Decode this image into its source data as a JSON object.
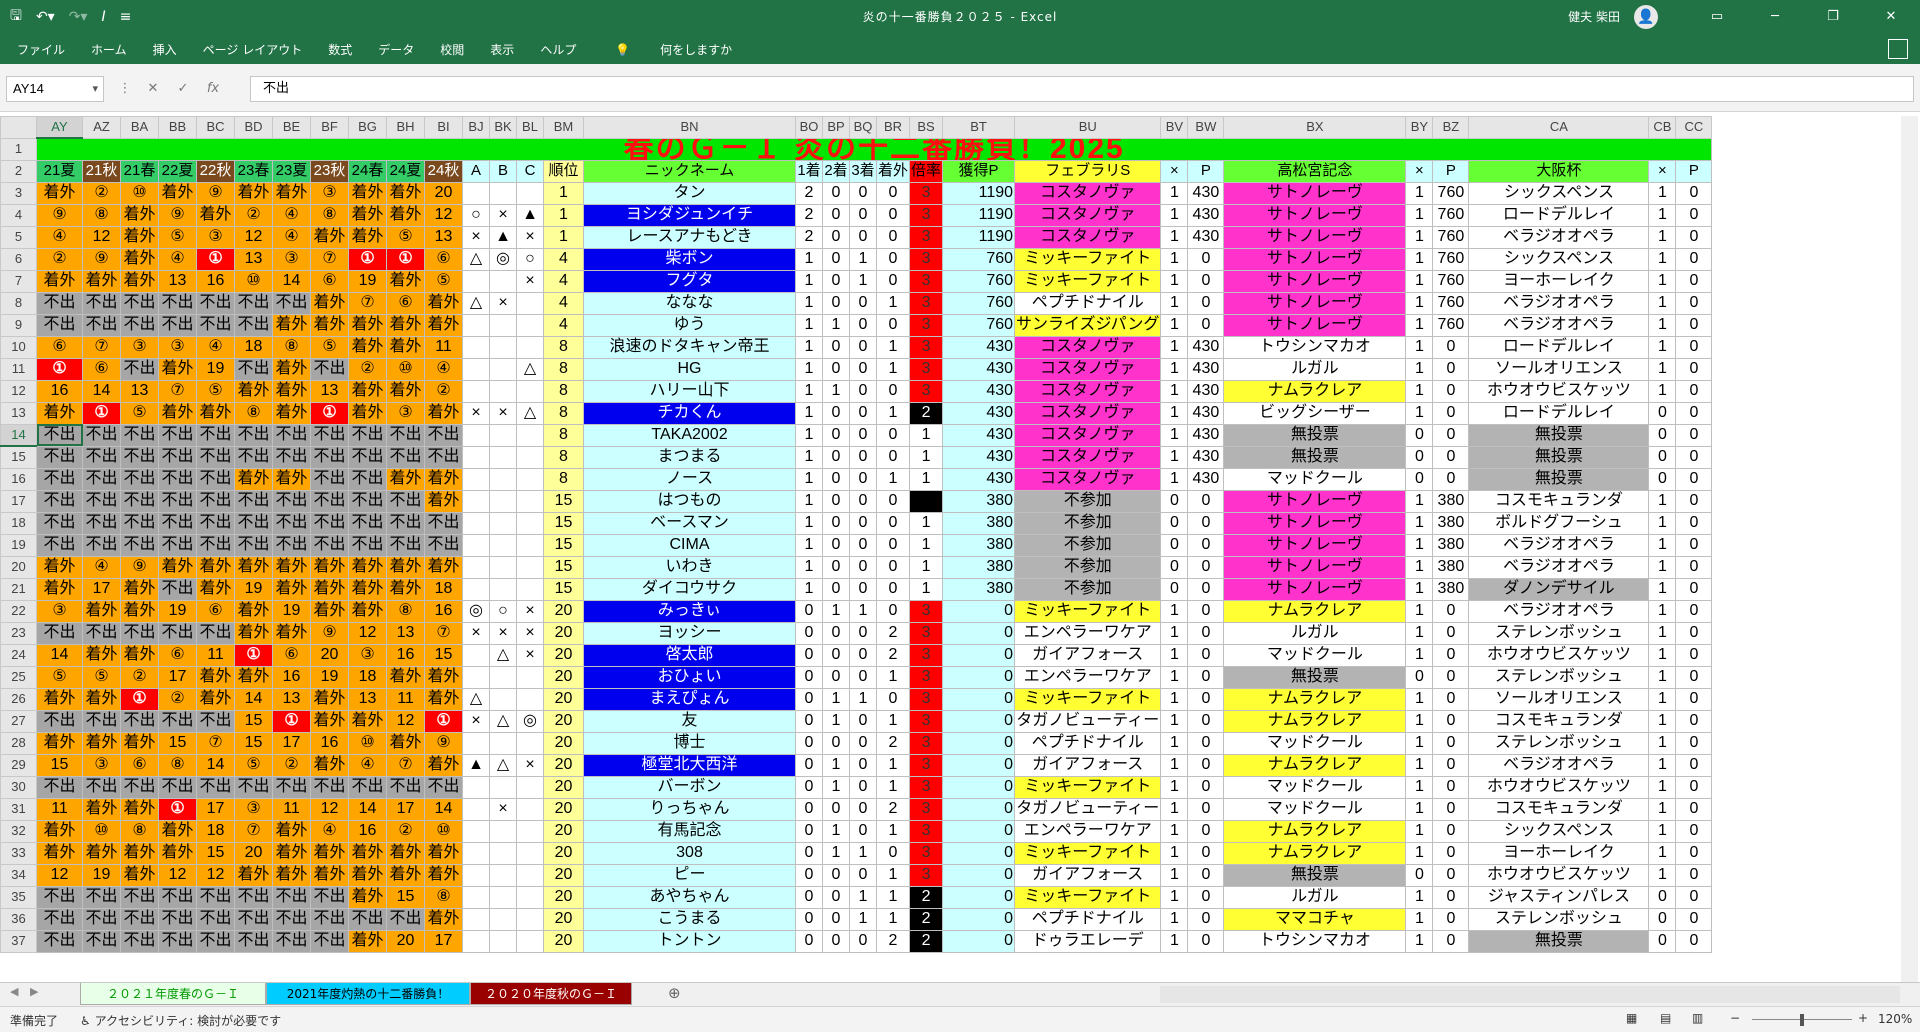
{
  "titlebar": {
    "title": "炎の十一番勝負２０２５  -  Excel",
    "user": "健夫 柴田"
  },
  "menus": [
    "ファイル",
    "ホーム",
    "挿入",
    "ページ レイアウト",
    "数式",
    "データ",
    "校閲",
    "表示",
    "ヘルプ",
    "何をしますか"
  ],
  "formula": {
    "cell": "AY14",
    "value": "不出"
  },
  "columns": [
    "AY",
    "AZ",
    "BA",
    "BB",
    "BC",
    "BD",
    "BE",
    "BF",
    "BG",
    "BH",
    "BI",
    "BJ",
    "BK",
    "BL",
    "BM",
    "BN",
    "BO",
    "BP",
    "BQ",
    "BR",
    "BS",
    "BT",
    "BU",
    "BV",
    "BW",
    "BX",
    "BY",
    "BZ",
    "CA",
    "CB",
    "CC"
  ],
  "banner": "春のＧ－Ｉ 炎の十二番勝負！2025",
  "header": [
    "21夏",
    "21秋",
    "21春",
    "22夏",
    "22秋",
    "23春",
    "23夏",
    "23秋",
    "24春",
    "24夏",
    "24秋",
    "A",
    "B",
    "C",
    "順位",
    "ニックネーム",
    "1着",
    "2着",
    "3着",
    "着外",
    "倍率",
    "獲得P",
    "フェブラリS",
    "×",
    "P",
    "高松宮記念",
    "×",
    "P",
    "大阪杯",
    "×",
    "P"
  ],
  "rows": [
    [
      "着外",
      "②",
      "⑩",
      "着外",
      "⑨",
      "着外",
      "着外",
      "③",
      "着外",
      "着外",
      "20",
      "",
      "",
      "",
      "1",
      "タン",
      "2",
      "0",
      "0",
      "0",
      "3",
      "1190",
      "コスタノヴァ",
      "1",
      "430",
      "サトノレーヴ",
      "1",
      "760",
      "シックスペンス",
      "1",
      "0"
    ],
    [
      "⑨",
      "⑧",
      "着外",
      "⑨",
      "着外",
      "②",
      "④",
      "⑧",
      "着外",
      "着外",
      "12",
      "○",
      "×",
      "▲",
      "1",
      "ヨシダジュンイチ",
      "2",
      "0",
      "0",
      "0",
      "3",
      "1190",
      "コスタノヴァ",
      "1",
      "430",
      "サトノレーヴ",
      "1",
      "760",
      "ロードデルレイ",
      "1",
      "0"
    ],
    [
      "④",
      "12",
      "着外",
      "⑤",
      "③",
      "12",
      "④",
      "着外",
      "着外",
      "⑤",
      "13",
      "×",
      "▲",
      "×",
      "1",
      "レースアナもどき",
      "2",
      "0",
      "0",
      "0",
      "3",
      "1190",
      "コスタノヴァ",
      "1",
      "430",
      "サトノレーヴ",
      "1",
      "760",
      "ベラジオオペラ",
      "1",
      "0"
    ],
    [
      "②",
      "⑨",
      "着外",
      "④",
      "①",
      "13",
      "③",
      "⑦",
      "①",
      "①",
      "⑥",
      "△",
      "◎",
      "○",
      "4",
      "柴ボン",
      "1",
      "0",
      "1",
      "0",
      "3",
      "760",
      "ミッキーファイト",
      "1",
      "0",
      "サトノレーヴ",
      "1",
      "760",
      "シックスペンス",
      "1",
      "0"
    ],
    [
      "着外",
      "着外",
      "着外",
      "13",
      "16",
      "⑩",
      "14",
      "⑥",
      "19",
      "着外",
      "⑤",
      "",
      "",
      "×",
      "4",
      "フグタ",
      "1",
      "0",
      "1",
      "0",
      "3",
      "760",
      "ミッキーファイト",
      "1",
      "0",
      "サトノレーヴ",
      "1",
      "760",
      "ヨーホーレイク",
      "1",
      "0"
    ],
    [
      "不出",
      "不出",
      "不出",
      "不出",
      "不出",
      "不出",
      "不出",
      "着外",
      "⑦",
      "⑥",
      "着外",
      "△",
      "×",
      "",
      "4",
      "ななな",
      "1",
      "0",
      "0",
      "1",
      "3",
      "760",
      "ペプチドナイル",
      "1",
      "0",
      "サトノレーヴ",
      "1",
      "760",
      "ベラジオオペラ",
      "1",
      "0"
    ],
    [
      "不出",
      "不出",
      "不出",
      "不出",
      "不出",
      "不出",
      "着外",
      "着外",
      "着外",
      "着外",
      "着外",
      "",
      "",
      "",
      "4",
      "ゆう",
      "1",
      "1",
      "0",
      "0",
      "3",
      "760",
      "サンライズジパング",
      "1",
      "0",
      "サトノレーヴ",
      "1",
      "760",
      "ベラジオオペラ",
      "1",
      "0"
    ],
    [
      "⑥",
      "⑦",
      "③",
      "③",
      "④",
      "18",
      "⑧",
      "⑤",
      "着外",
      "着外",
      "11",
      "",
      "",
      "",
      "8",
      "浪速のドタキャン帝王",
      "1",
      "0",
      "0",
      "1",
      "3",
      "430",
      "コスタノヴァ",
      "1",
      "430",
      "トウシンマカオ",
      "1",
      "0",
      "ロードデルレイ",
      "1",
      "0"
    ],
    [
      "①",
      "⑥",
      "不出",
      "着外",
      "19",
      "不出",
      "着外",
      "不出",
      "②",
      "⑩",
      "④",
      "",
      "",
      "△",
      "8",
      "HG",
      "1",
      "0",
      "0",
      "1",
      "3",
      "430",
      "コスタノヴァ",
      "1",
      "430",
      "ルガル",
      "1",
      "0",
      "ソールオリエンス",
      "1",
      "0"
    ],
    [
      "16",
      "14",
      "13",
      "⑦",
      "⑤",
      "着外",
      "着外",
      "13",
      "着外",
      "着外",
      "②",
      "",
      "",
      "",
      "8",
      "ハリー山下",
      "1",
      "1",
      "0",
      "0",
      "3",
      "430",
      "コスタノヴァ",
      "1",
      "430",
      "ナムラクレア",
      "1",
      "0",
      "ホウオウビスケッツ",
      "1",
      "0"
    ],
    [
      "着外",
      "①",
      "⑤",
      "着外",
      "着外",
      "⑧",
      "着外",
      "①",
      "着外",
      "③",
      "着外",
      "×",
      "×",
      "△",
      "8",
      "チカくん",
      "1",
      "0",
      "0",
      "1",
      "2",
      "430",
      "コスタノヴァ",
      "1",
      "430",
      "ビッグシーザー",
      "1",
      "0",
      "ロードデルレイ",
      "0",
      "0"
    ],
    [
      "不出",
      "不出",
      "不出",
      "不出",
      "不出",
      "不出",
      "不出",
      "不出",
      "不出",
      "不出",
      "不出",
      "",
      "",
      "",
      "8",
      "TAKA2002",
      "1",
      "0",
      "0",
      "0",
      "1",
      "430",
      "コスタノヴァ",
      "1",
      "430",
      "無投票",
      "0",
      "0",
      "無投票",
      "0",
      "0"
    ],
    [
      "不出",
      "不出",
      "不出",
      "不出",
      "不出",
      "不出",
      "不出",
      "不出",
      "不出",
      "不出",
      "不出",
      "",
      "",
      "",
      "8",
      "まつまる",
      "1",
      "0",
      "0",
      "0",
      "1",
      "430",
      "コスタノヴァ",
      "1",
      "430",
      "無投票",
      "0",
      "0",
      "無投票",
      "0",
      "0"
    ],
    [
      "不出",
      "不出",
      "不出",
      "不出",
      "不出",
      "着外",
      "着外",
      "不出",
      "不出",
      "着外",
      "着外",
      "",
      "",
      "",
      "8",
      "ノース",
      "1",
      "0",
      "0",
      "1",
      "1",
      "430",
      "コスタノヴァ",
      "1",
      "430",
      "マッドクール",
      "0",
      "0",
      "無投票",
      "0",
      "0"
    ],
    [
      "不出",
      "不出",
      "不出",
      "不出",
      "不出",
      "不出",
      "不出",
      "不出",
      "不出",
      "不出",
      "着外",
      "",
      "",
      "",
      "15",
      "はつもの",
      "1",
      "0",
      "0",
      "0",
      "",
      "380",
      "不参加",
      "0",
      "0",
      "サトノレーヴ",
      "1",
      "380",
      "コスモキュランダ",
      "1",
      "0"
    ],
    [
      "不出",
      "不出",
      "不出",
      "不出",
      "不出",
      "不出",
      "不出",
      "不出",
      "不出",
      "不出",
      "不出",
      "",
      "",
      "",
      "15",
      "ベースマン",
      "1",
      "0",
      "0",
      "0",
      "1",
      "380",
      "不参加",
      "0",
      "0",
      "サトノレーヴ",
      "1",
      "380",
      "ボルドグフーシュ",
      "1",
      "0"
    ],
    [
      "不出",
      "不出",
      "不出",
      "不出",
      "不出",
      "不出",
      "不出",
      "不出",
      "不出",
      "不出",
      "不出",
      "",
      "",
      "",
      "15",
      "CIMA",
      "1",
      "0",
      "0",
      "0",
      "1",
      "380",
      "不参加",
      "0",
      "0",
      "サトノレーヴ",
      "1",
      "380",
      "ベラジオオペラ",
      "1",
      "0"
    ],
    [
      "着外",
      "④",
      "⑨",
      "着外",
      "着外",
      "着外",
      "着外",
      "着外",
      "着外",
      "着外",
      "着外",
      "",
      "",
      "",
      "15",
      "いわき",
      "1",
      "0",
      "0",
      "0",
      "1",
      "380",
      "不参加",
      "0",
      "0",
      "サトノレーヴ",
      "1",
      "380",
      "ベラジオオペラ",
      "1",
      "0"
    ],
    [
      "着外",
      "17",
      "着外",
      "不出",
      "着外",
      "19",
      "着外",
      "着外",
      "着外",
      "着外",
      "18",
      "",
      "",
      "",
      "15",
      "ダイコウサク",
      "1",
      "0",
      "0",
      "0",
      "1",
      "380",
      "不参加",
      "0",
      "0",
      "サトノレーヴ",
      "1",
      "380",
      "ダノンデサイル",
      "1",
      "0"
    ],
    [
      "③",
      "着外",
      "着外",
      "19",
      "⑥",
      "着外",
      "19",
      "着外",
      "着外",
      "⑧",
      "16",
      "◎",
      "○",
      "×",
      "20",
      "みっきぃ",
      "0",
      "1",
      "1",
      "0",
      "3",
      "0",
      "ミッキーファイト",
      "1",
      "0",
      "ナムラクレア",
      "1",
      "0",
      "ベラジオオペラ",
      "1",
      "0"
    ],
    [
      "不出",
      "不出",
      "不出",
      "不出",
      "不出",
      "着外",
      "着外",
      "⑨",
      "12",
      "13",
      "⑦",
      "×",
      "×",
      "×",
      "20",
      "ヨッシー",
      "0",
      "0",
      "0",
      "2",
      "3",
      "0",
      "エンペラーワケア",
      "1",
      "0",
      "ルガル",
      "1",
      "0",
      "ステレンボッシュ",
      "1",
      "0"
    ],
    [
      "14",
      "着外",
      "着外",
      "⑥",
      "11",
      "①",
      "⑥",
      "20",
      "③",
      "16",
      "15",
      "",
      "△",
      "×",
      "20",
      "啓太郎",
      "0",
      "0",
      "0",
      "2",
      "3",
      "0",
      "ガイアフォース",
      "1",
      "0",
      "マッドクール",
      "1",
      "0",
      "ホウオウビスケッツ",
      "1",
      "0"
    ],
    [
      "⑤",
      "⑤",
      "②",
      "17",
      "着外",
      "着外",
      "16",
      "19",
      "18",
      "着外",
      "着外",
      "",
      "",
      "",
      "20",
      "おひょい",
      "0",
      "0",
      "0",
      "1",
      "3",
      "0",
      "エンペラーワケア",
      "1",
      "0",
      "無投票",
      "0",
      "0",
      "ステレンボッシュ",
      "1",
      "0"
    ],
    [
      "着外",
      "着外",
      "①",
      "②",
      "着外",
      "14",
      "13",
      "着外",
      "13",
      "11",
      "着外",
      "△",
      "",
      "",
      "20",
      "まえぴょん",
      "0",
      "1",
      "1",
      "0",
      "3",
      "0",
      "ミッキーファイト",
      "1",
      "0",
      "ナムラクレア",
      "1",
      "0",
      "ソールオリエンス",
      "1",
      "0"
    ],
    [
      "不出",
      "不出",
      "不出",
      "不出",
      "不出",
      "15",
      "①",
      "着外",
      "着外",
      "12",
      "①",
      "×",
      "△",
      "◎",
      "20",
      "友",
      "0",
      "1",
      "0",
      "1",
      "3",
      "0",
      "タガノビューティー",
      "1",
      "0",
      "ナムラクレア",
      "1",
      "0",
      "コスモキュランダ",
      "1",
      "0"
    ],
    [
      "着外",
      "着外",
      "着外",
      "15",
      "⑦",
      "15",
      "17",
      "16",
      "⑩",
      "着外",
      "⑨",
      "",
      "",
      "",
      "20",
      "博士",
      "0",
      "0",
      "0",
      "2",
      "3",
      "0",
      "ペプチドナイル",
      "1",
      "0",
      "マッドクール",
      "1",
      "0",
      "ステレンボッシュ",
      "1",
      "0"
    ],
    [
      "15",
      "③",
      "⑥",
      "⑧",
      "14",
      "⑤",
      "②",
      "着外",
      "④",
      "⑦",
      "着外",
      "▲",
      "△",
      "×",
      "20",
      "極堂北大西洋",
      "0",
      "1",
      "0",
      "1",
      "3",
      "0",
      "ガイアフォース",
      "1",
      "0",
      "ナムラクレア",
      "1",
      "0",
      "ベラジオオペラ",
      "1",
      "0"
    ],
    [
      "不出",
      "不出",
      "不出",
      "不出",
      "不出",
      "不出",
      "不出",
      "不出",
      "不出",
      "不出",
      "不出",
      "",
      "",
      "",
      "20",
      "バーボン",
      "0",
      "1",
      "0",
      "1",
      "3",
      "0",
      "ミッキーファイト",
      "1",
      "0",
      "マッドクール",
      "1",
      "0",
      "ホウオウビスケッツ",
      "1",
      "0"
    ],
    [
      "11",
      "着外",
      "着外",
      "①",
      "17",
      "③",
      "11",
      "12",
      "14",
      "17",
      "14",
      "",
      "×",
      "",
      "20",
      "りっちゃん",
      "0",
      "0",
      "0",
      "2",
      "3",
      "0",
      "タガノビューティー",
      "1",
      "0",
      "マッドクール",
      "1",
      "0",
      "コスモキュランダ",
      "1",
      "0"
    ],
    [
      "着外",
      "⑩",
      "⑧",
      "着外",
      "18",
      "⑦",
      "着外",
      "④",
      "16",
      "②",
      "⑩",
      "",
      "",
      "",
      "20",
      "有馬記念",
      "0",
      "1",
      "0",
      "1",
      "3",
      "0",
      "エンペラーワケア",
      "1",
      "0",
      "ナムラクレア",
      "1",
      "0",
      "シックスペンス",
      "1",
      "0"
    ],
    [
      "着外",
      "着外",
      "着外",
      "着外",
      "15",
      "20",
      "着外",
      "着外",
      "着外",
      "着外",
      "着外",
      "",
      "",
      "",
      "20",
      "308",
      "0",
      "1",
      "1",
      "0",
      "3",
      "0",
      "ミッキーファイト",
      "1",
      "0",
      "ナムラクレア",
      "1",
      "0",
      "ヨーホーレイク",
      "1",
      "0"
    ],
    [
      "12",
      "19",
      "着外",
      "12",
      "12",
      "着外",
      "着外",
      "着外",
      "着外",
      "着外",
      "着外",
      "",
      "",
      "",
      "20",
      "ピー",
      "0",
      "0",
      "0",
      "1",
      "3",
      "0",
      "ガイアフォース",
      "1",
      "0",
      "無投票",
      "0",
      "0",
      "ホウオウビスケッツ",
      "1",
      "0"
    ],
    [
      "不出",
      "不出",
      "不出",
      "不出",
      "不出",
      "不出",
      "不出",
      "不出",
      "着外",
      "15",
      "⑧",
      "",
      "",
      "",
      "20",
      "あやちゃん",
      "0",
      "0",
      "1",
      "1",
      "2",
      "0",
      "ミッキーファイト",
      "1",
      "0",
      "ルガル",
      "1",
      "0",
      "ジャスティンパレス",
      "0",
      "0"
    ],
    [
      "不出",
      "不出",
      "不出",
      "不出",
      "不出",
      "不出",
      "不出",
      "不出",
      "不出",
      "不出",
      "着外",
      "",
      "",
      "",
      "20",
      "こうまる",
      "0",
      "0",
      "1",
      "1",
      "2",
      "0",
      "ペプチドナイル",
      "1",
      "0",
      "ママコチャ",
      "1",
      "0",
      "ステレンボッシュ",
      "0",
      "0"
    ],
    [
      "不出",
      "不出",
      "不出",
      "不出",
      "不出",
      "不出",
      "不出",
      "不出",
      "着外",
      "20",
      "17",
      "",
      "",
      "",
      "20",
      "トントン",
      "0",
      "0",
      "0",
      "2",
      "2",
      "0",
      "ドゥラエレーデ",
      "1",
      "0",
      "トウシンマカオ",
      "1",
      "0",
      "無投票",
      "0",
      "0"
    ]
  ],
  "sheets": [
    "２０２１年度春のＧ－Ｉ",
    "2021年度灼熱の十二番勝負！",
    "２０２０年度秋のＧ－Ｉ"
  ],
  "status": {
    "ready": "準備完了",
    "accessibility": "アクセシビリティ: 検討が必要です",
    "zoom": "120%"
  }
}
